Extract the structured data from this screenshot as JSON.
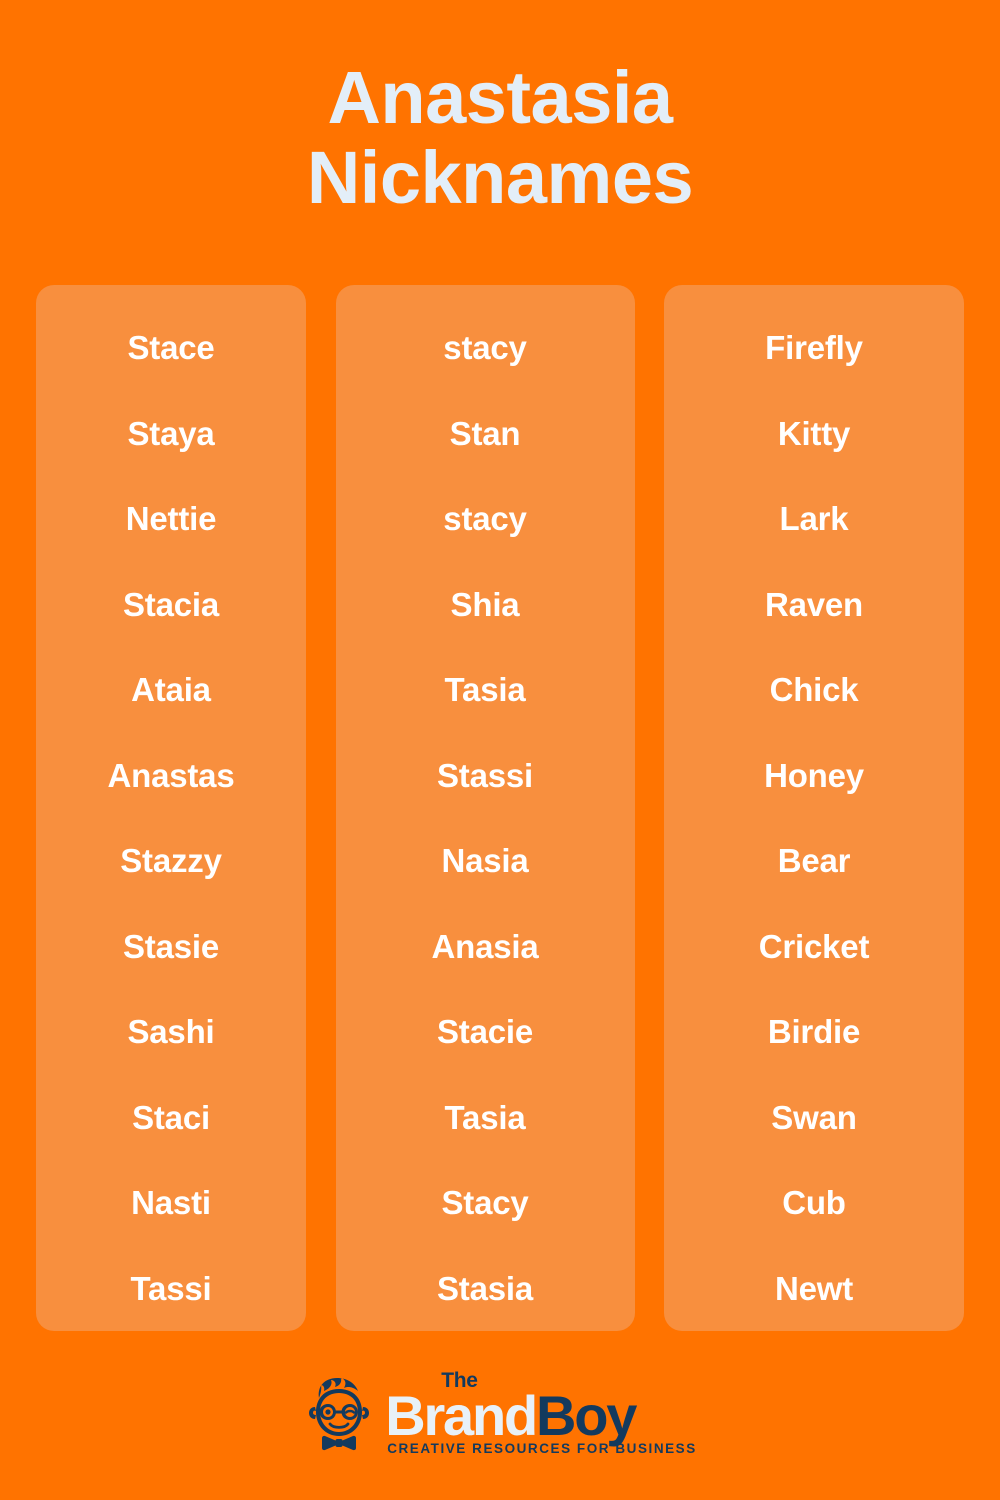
{
  "header": {
    "title_line_1": "Anastasia",
    "title_line_2": "Nicknames",
    "title_color": "#E3EEF8"
  },
  "theme": {
    "background_color": "#FF7300",
    "card_color": "#F88F3E",
    "name_text_color": "#FFFFFF",
    "logo_dark_color": "#133A5E",
    "logo_light_color": "#E8F1F8"
  },
  "columns": [
    {
      "id": "column-1",
      "names": [
        "Stace",
        "Staya",
        "Nettie",
        "Stacia",
        "Ataia",
        "Anastas",
        "Stazzy",
        "Stasie",
        "Sashi",
        "Staci",
        "Nasti",
        "Tassi"
      ]
    },
    {
      "id": "column-2",
      "names": [
        "stacy",
        "Stan",
        "stacy",
        "Shia",
        "Tasia",
        "Stassi",
        "Nasia",
        "Anasia",
        "Stacie",
        "Tasia",
        "Stacy",
        "Stasia"
      ]
    },
    {
      "id": "column-3",
      "names": [
        "Firefly",
        "Kitty",
        "Lark",
        "Raven",
        "Chick",
        "Honey",
        "Bear",
        "Cricket",
        "Birdie",
        "Swan",
        "Cub",
        "Newt"
      ]
    }
  ],
  "footer": {
    "logo_the": "The",
    "logo_brand": "Brand",
    "logo_boy": "Boy",
    "logo_tagline": "CREATIVE RESOURCES FOR BUSINESS",
    "mascot_icon": "boy-with-glasses-and-bowtie-icon"
  }
}
